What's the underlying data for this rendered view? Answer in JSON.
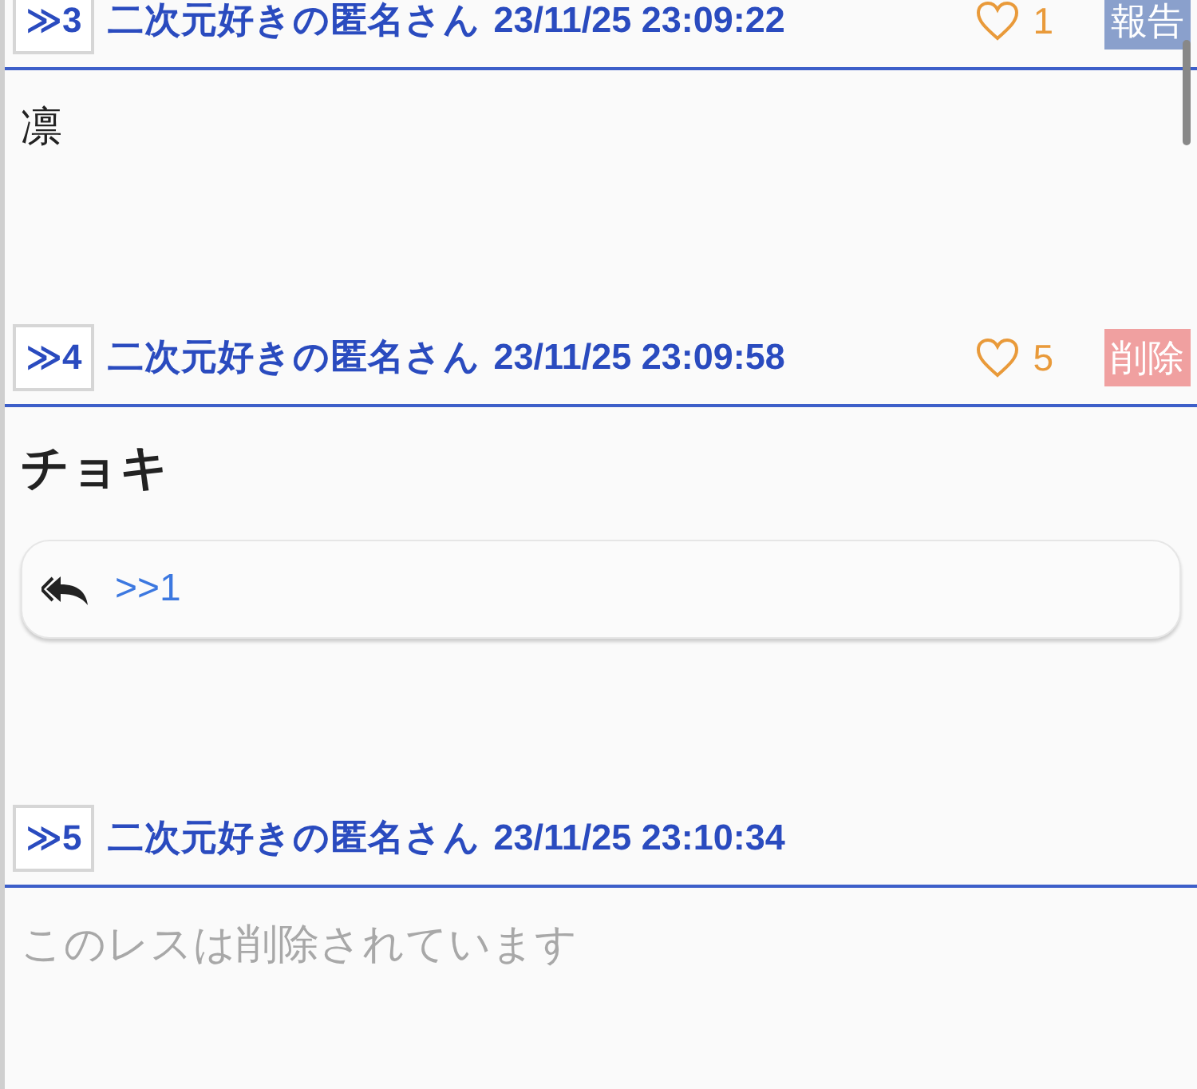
{
  "posts": [
    {
      "number": "≫3",
      "author": "二次元好きの匿名さん",
      "date": "23/11/25 23:09:22",
      "likes": "1",
      "action": {
        "kind": "report",
        "label": "報告"
      },
      "body": {
        "kind": "plain",
        "text": "凛"
      }
    },
    {
      "number": "≫4",
      "author": "二次元好きの匿名さん",
      "date": "23/11/25 23:09:58",
      "likes": "5",
      "action": {
        "kind": "delete",
        "label": "削除"
      },
      "body": {
        "kind": "bold",
        "text": "チョキ"
      },
      "replies": [
        ">>1"
      ]
    },
    {
      "number": "≫5",
      "author": "二次元好きの匿名さん",
      "date": "23/11/25 23:10:34",
      "body": {
        "kind": "deleted",
        "text": "このレスは削除されています"
      }
    }
  ]
}
